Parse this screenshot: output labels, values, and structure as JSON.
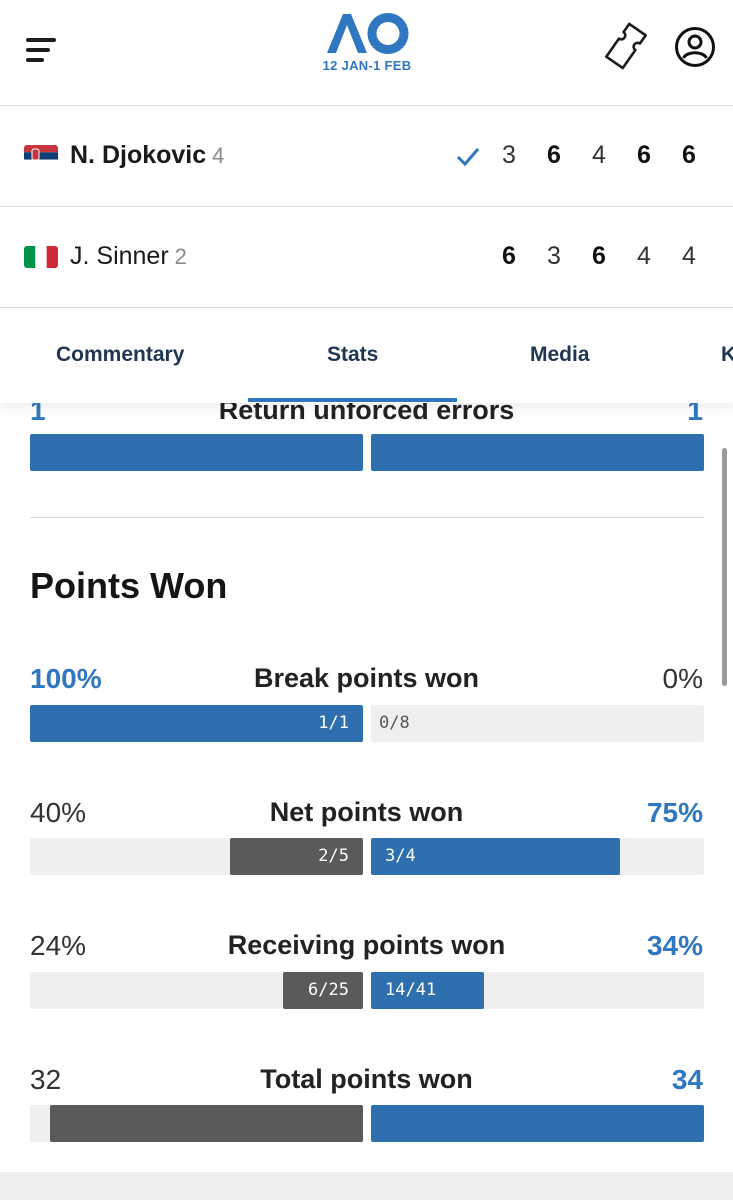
{
  "header": {
    "menu_icon": "hamburger-menu-icon",
    "logo_text": "AO",
    "dates": "12 JAN-1 FEB",
    "ticket_icon": "ticket-icon",
    "account_icon": "user-account-icon",
    "brand_color": "#2f77c0"
  },
  "match": {
    "players": [
      {
        "name": "N. Djokovic",
        "seed": "4",
        "flag": "serbia-flag",
        "winner": true,
        "sets": [
          "3",
          "6",
          "4",
          "6",
          "6"
        ]
      },
      {
        "name": "J. Sinner",
        "seed": "2",
        "flag": "italy-flag",
        "winner": false,
        "sets": [
          "6",
          "3",
          "6",
          "4",
          "4"
        ]
      }
    ],
    "winner_icon": "checkmark-icon"
  },
  "tabs": [
    {
      "label": "Commentary",
      "active": false
    },
    {
      "label": "Stats",
      "active": true
    },
    {
      "label": "Media",
      "active": false
    },
    {
      "label": "K",
      "active": false
    }
  ],
  "stats_top": {
    "label": "Return unforced errors",
    "left": "1",
    "right": "1"
  },
  "section": {
    "title": "Points Won"
  },
  "points_won": [
    {
      "label": "Break points won",
      "left": "100%",
      "right": "0%",
      "left_frac": "1/1",
      "right_frac": "0/8",
      "left_ratio": 1.0,
      "right_ratio": 0.0,
      "leader": "left"
    },
    {
      "label": "Net points won",
      "left": "40%",
      "right": "75%",
      "left_frac": "2/5",
      "right_frac": "3/4",
      "left_ratio": 0.4,
      "right_ratio": 0.75,
      "leader": "right"
    },
    {
      "label": "Receiving points won",
      "left": "24%",
      "right": "34%",
      "left_frac": "6/25",
      "right_frac": "14/41",
      "left_ratio": 0.24,
      "right_ratio": 0.34,
      "leader": "right"
    },
    {
      "label": "Total points won",
      "left": "32",
      "right": "34",
      "leader": "right"
    }
  ]
}
